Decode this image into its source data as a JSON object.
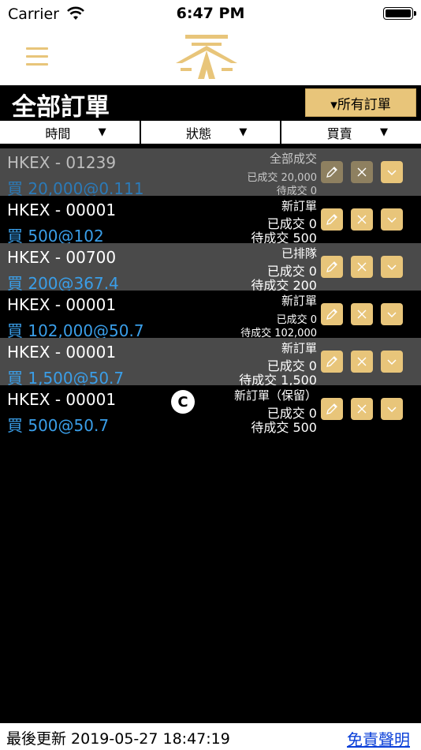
{
  "status_bar": {
    "carrier": "Carrier",
    "time": "6:47 PM"
  },
  "header": {
    "title": "全部訂單",
    "filter_label": "▾所有訂單"
  },
  "sort": [
    {
      "label": "時間",
      "arrow": "▼"
    },
    {
      "label": "狀態",
      "arrow": "▼"
    },
    {
      "label": "買賣",
      "arrow": "▼"
    }
  ],
  "orders": [
    {
      "code": "HKEX - 01239",
      "detail": "買 20,000@0.111",
      "status": "全部成交",
      "filled": "已成交 20,000",
      "pending": "待成交 0"
    },
    {
      "code": "HKEX - 00001",
      "detail": "買 500@102",
      "status": "新訂單",
      "filled": "已成交 0",
      "pending": "待成交 500"
    },
    {
      "code": "HKEX - 00700",
      "detail": "買 200@367.4",
      "status": "已排隊",
      "filled": "已成交 0",
      "pending": "待成交 200"
    },
    {
      "code": "HKEX - 00001",
      "detail": "買 102,000@50.7",
      "status": "新訂單",
      "filled": "已成交 0",
      "pending": "待成交 102,000"
    },
    {
      "code": "HKEX - 00001",
      "detail": "買 1,500@50.7",
      "status": "新訂單",
      "filled": "已成交 0",
      "pending": "待成交 1,500"
    },
    {
      "code": "HKEX - 00001",
      "detail": "買 500@50.7",
      "status": "新訂單（保留）",
      "filled": "已成交 0",
      "pending": "待成交 500"
    }
  ],
  "badge": "C",
  "footer": {
    "updated": "最後更新 2019-05-27 18:47:19",
    "disclaimer": "免責聲明"
  },
  "colors": {
    "accent": "#e8c57a",
    "buy_blue": "#3a9ee8",
    "link_blue": "#0a3fd8"
  }
}
